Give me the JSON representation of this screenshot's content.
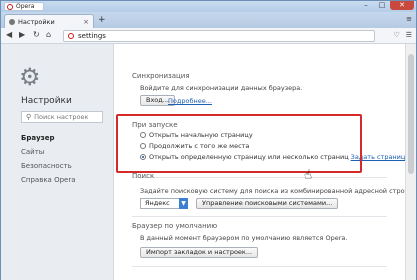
{
  "window": {
    "app_badge": "Opera",
    "minimize": "–",
    "maximize": "□",
    "close": "✕"
  },
  "tab": {
    "label": "Настройки",
    "close": "×",
    "new_tab": "+",
    "menu": "≡"
  },
  "toolbar": {
    "back": "◀",
    "forward": "▶",
    "reload": "↻",
    "home": "⌂",
    "url": "settings",
    "heart": "♡",
    "menu": "☰"
  },
  "sidebar": {
    "title": "Настройки",
    "search_placeholder": "Поиск настроек",
    "items": [
      {
        "label": "Браузер",
        "active": true
      },
      {
        "label": "Сайты"
      },
      {
        "label": "Безопасность"
      },
      {
        "label": "Справка Opera"
      }
    ]
  },
  "sync": {
    "title": "Синхронизация",
    "text": "Войдите для синхронизации данных браузера.",
    "login_button": "Вход...",
    "more_link": "Подробнее..."
  },
  "startup": {
    "title": "При запуске",
    "options": [
      {
        "label": "Открыть начальную страницу",
        "selected": false
      },
      {
        "label": "Продолжить с того же места",
        "selected": false
      },
      {
        "label": "Открыть определенную страницу или несколько страниц",
        "selected": true
      }
    ],
    "set_pages_link": "Задать страницы"
  },
  "search": {
    "title": "Поиск",
    "text": "Задайте поисковую систему для поиска из комбинированной адресной строки",
    "engine": "Яндекс",
    "manage_button": "Управление поисковыми системами..."
  },
  "default_browser": {
    "title": "Браузер по умолчанию",
    "text": "В данный момент браузером по умолчанию является Opera.",
    "import_button": "Импорт закладок и настроек..."
  },
  "colors": {
    "highlight": "#d42a2a",
    "link": "#1a5fb4",
    "select_arrow": "#3d7fd0"
  }
}
